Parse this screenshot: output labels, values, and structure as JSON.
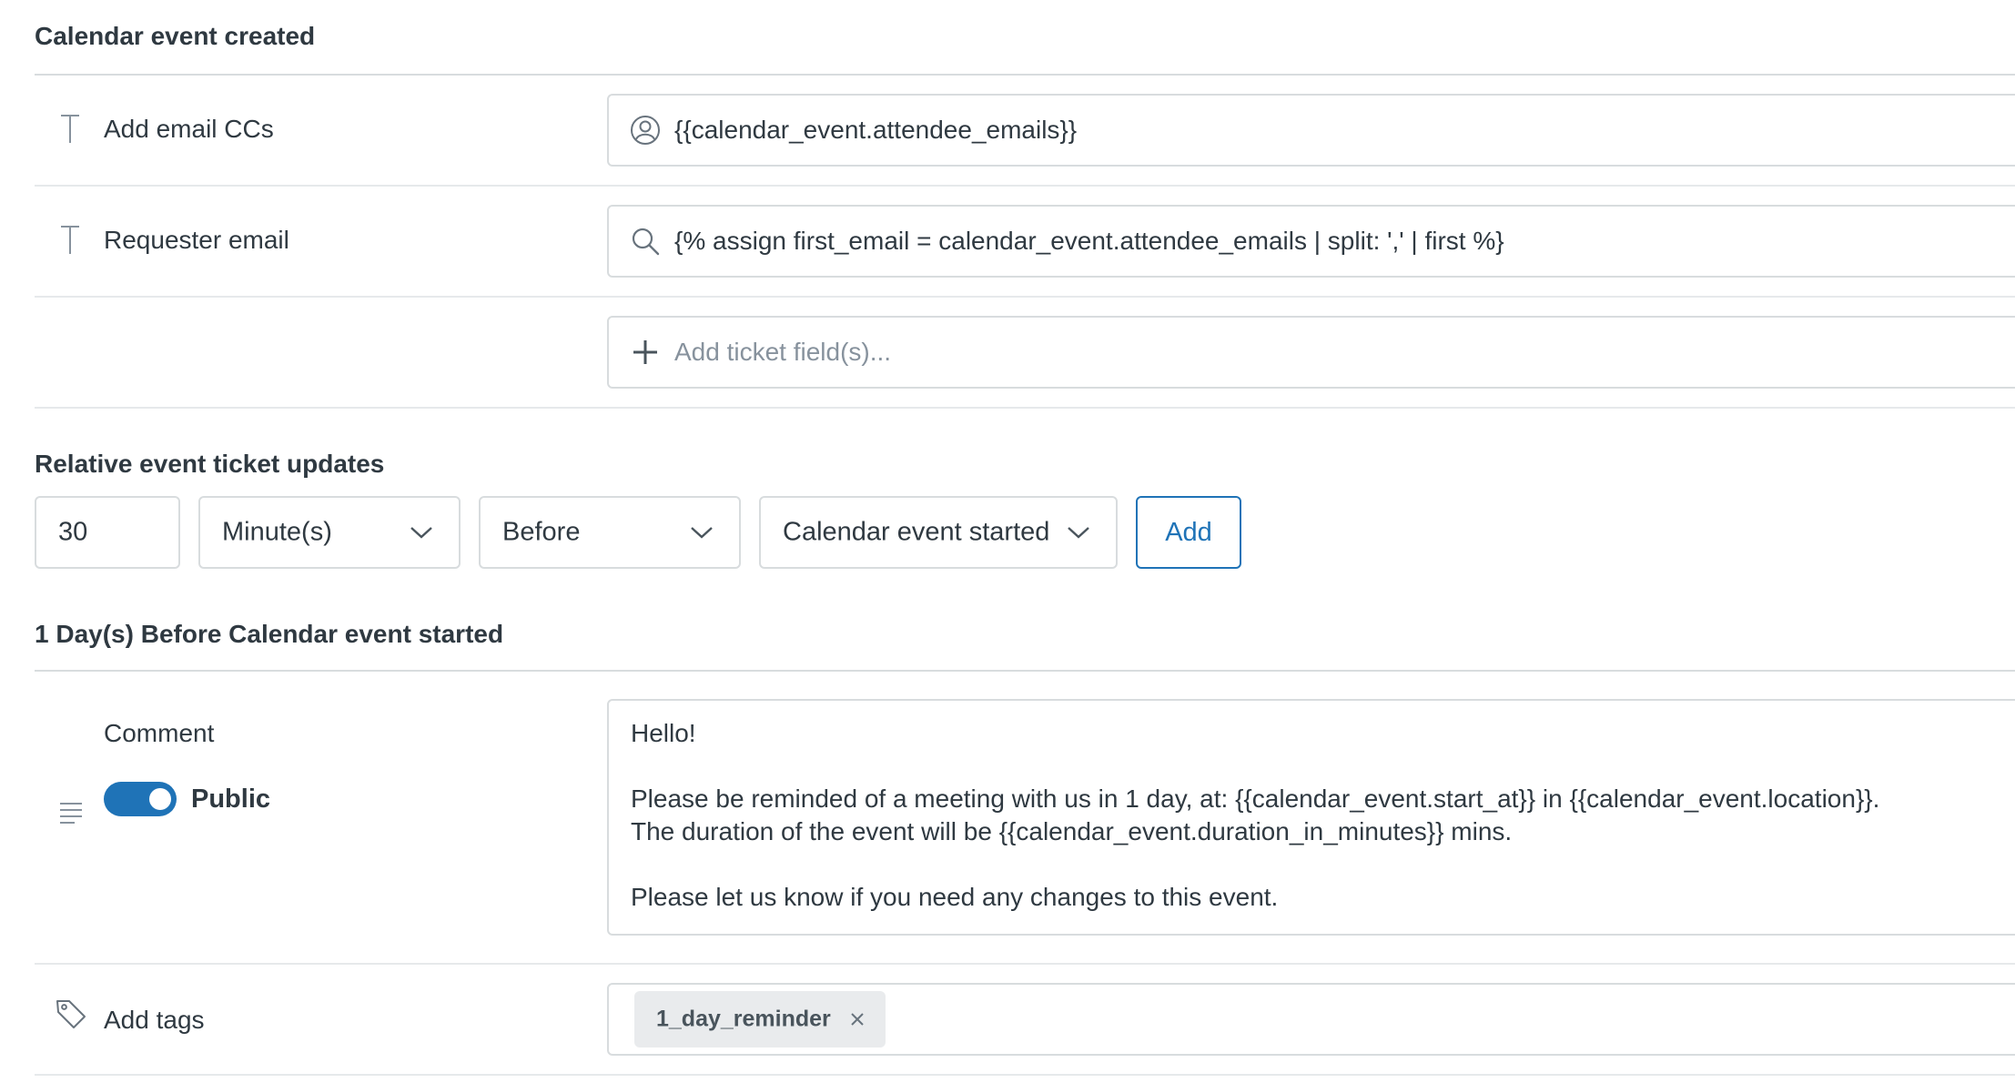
{
  "section1": {
    "title": "Calendar event created",
    "rows": [
      {
        "label": "Add email CCs",
        "icon": "text-field-icon",
        "field_icon": "user-circle-icon",
        "value": "{{calendar_event.attendee_emails}}"
      },
      {
        "label": "Requester email",
        "icon": "text-field-icon",
        "field_icon": "search-icon",
        "value": "{% assign first_email = calendar_event.attendee_emails | split: ',' | first %}"
      }
    ],
    "add_field_placeholder": "Add ticket field(s)..."
  },
  "relative": {
    "title": "Relative event ticket updates",
    "amount": "30",
    "unit": "Minute(s)",
    "direction": "Before",
    "event": "Calendar event started",
    "add_label": "Add"
  },
  "section2": {
    "title": "1 Day(s) Before Calendar event started",
    "comment_label": "Comment",
    "visibility_label": "Public",
    "comment_lines": [
      "Hello!",
      "",
      "Please be reminded of a meeting with us in 1 day, at: {{calendar_event.start_at}} in {{calendar_event.location}}.",
      "The duration of the event will be {{calendar_event.duration_in_minutes}} mins.",
      "",
      "Please let us know if you need any changes to this event."
    ],
    "tags_label": "Add tags",
    "tag": "1_day_reminder"
  },
  "colors": {
    "accent": "#1f73b7",
    "border": "#d8dcde",
    "text": "#2f3941",
    "muted": "#87929d"
  }
}
